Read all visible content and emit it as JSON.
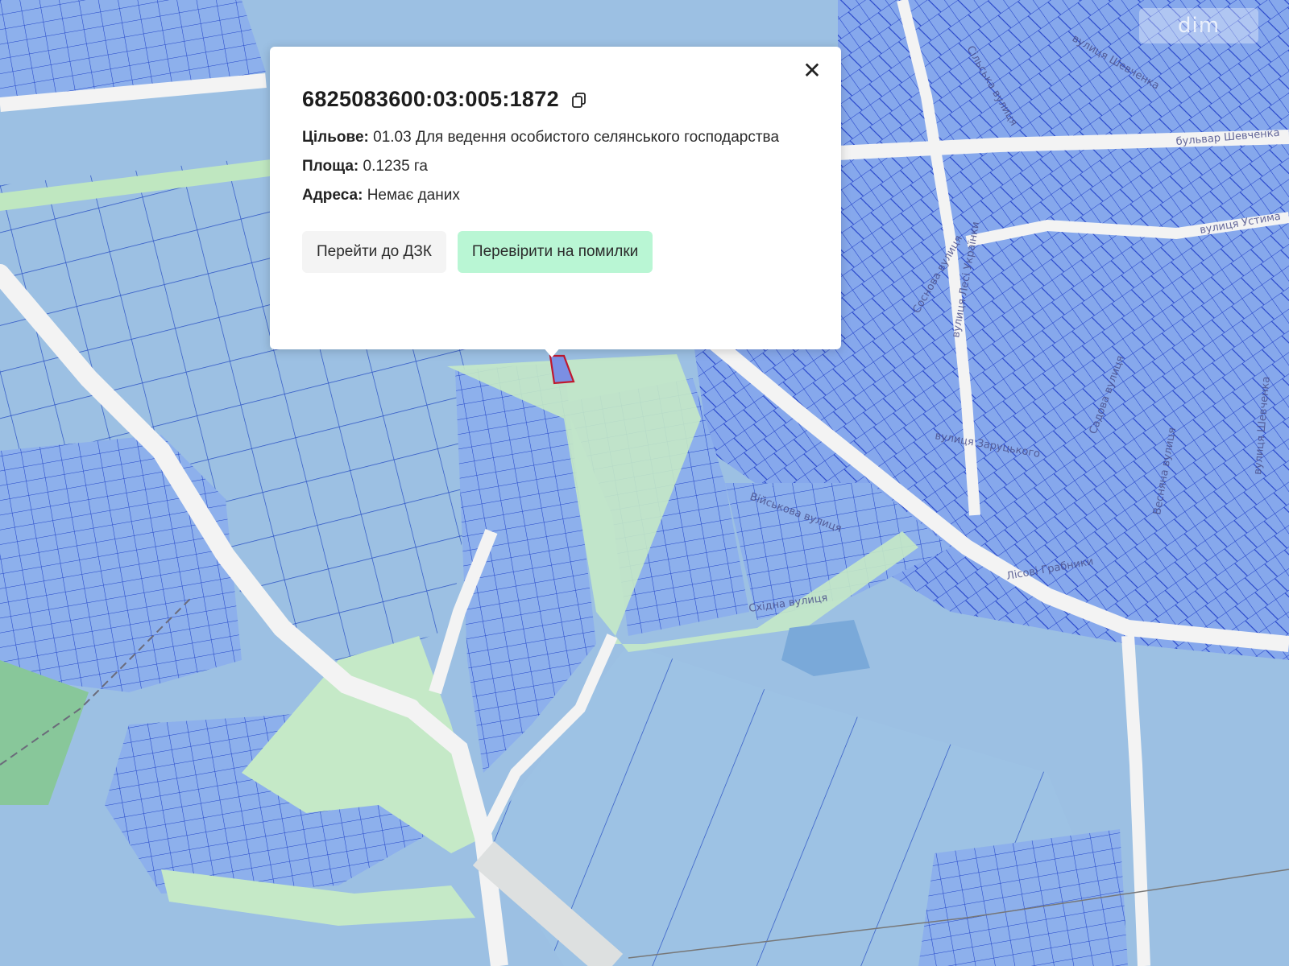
{
  "map": {
    "street_labels": [
      "Сільська вулиця",
      "вулиця Шевченка",
      "бульвар Шевченка",
      "вулиця Устима",
      "Соснова вулиця",
      "вулиця Лесі Українки",
      "вулиця Заруцького",
      "Садова вулиця",
      "Весняна вулиця",
      "вулиця Шевченка",
      "Військова вулиця",
      "Лісові Грабники",
      "Східна вулиця"
    ],
    "colors": {
      "parcel_fill": "#8fb0ec",
      "parcel_stroke": "#2345c9",
      "farmland_fill": "#99bfe0",
      "green_area": "#bfe7c0",
      "road": "#f3f3f3",
      "water": "#7aa9d9",
      "selected_parcel": "#c0182e"
    }
  },
  "watermark": {
    "text": "dim"
  },
  "popup": {
    "parcel_id": "6825083600:03:005:1872",
    "purpose_label": "Цільове:",
    "purpose_value": "01.03 Для ведення особистого селянського господарства",
    "area_label": "Площа:",
    "area_value": "0.1235 га",
    "address_label": "Адреса:",
    "address_value": "Немає даних",
    "close_symbol": "✕",
    "buttons": {
      "dzk": "Перейти до ДЗК",
      "check": "Перевірити на помилки"
    }
  }
}
